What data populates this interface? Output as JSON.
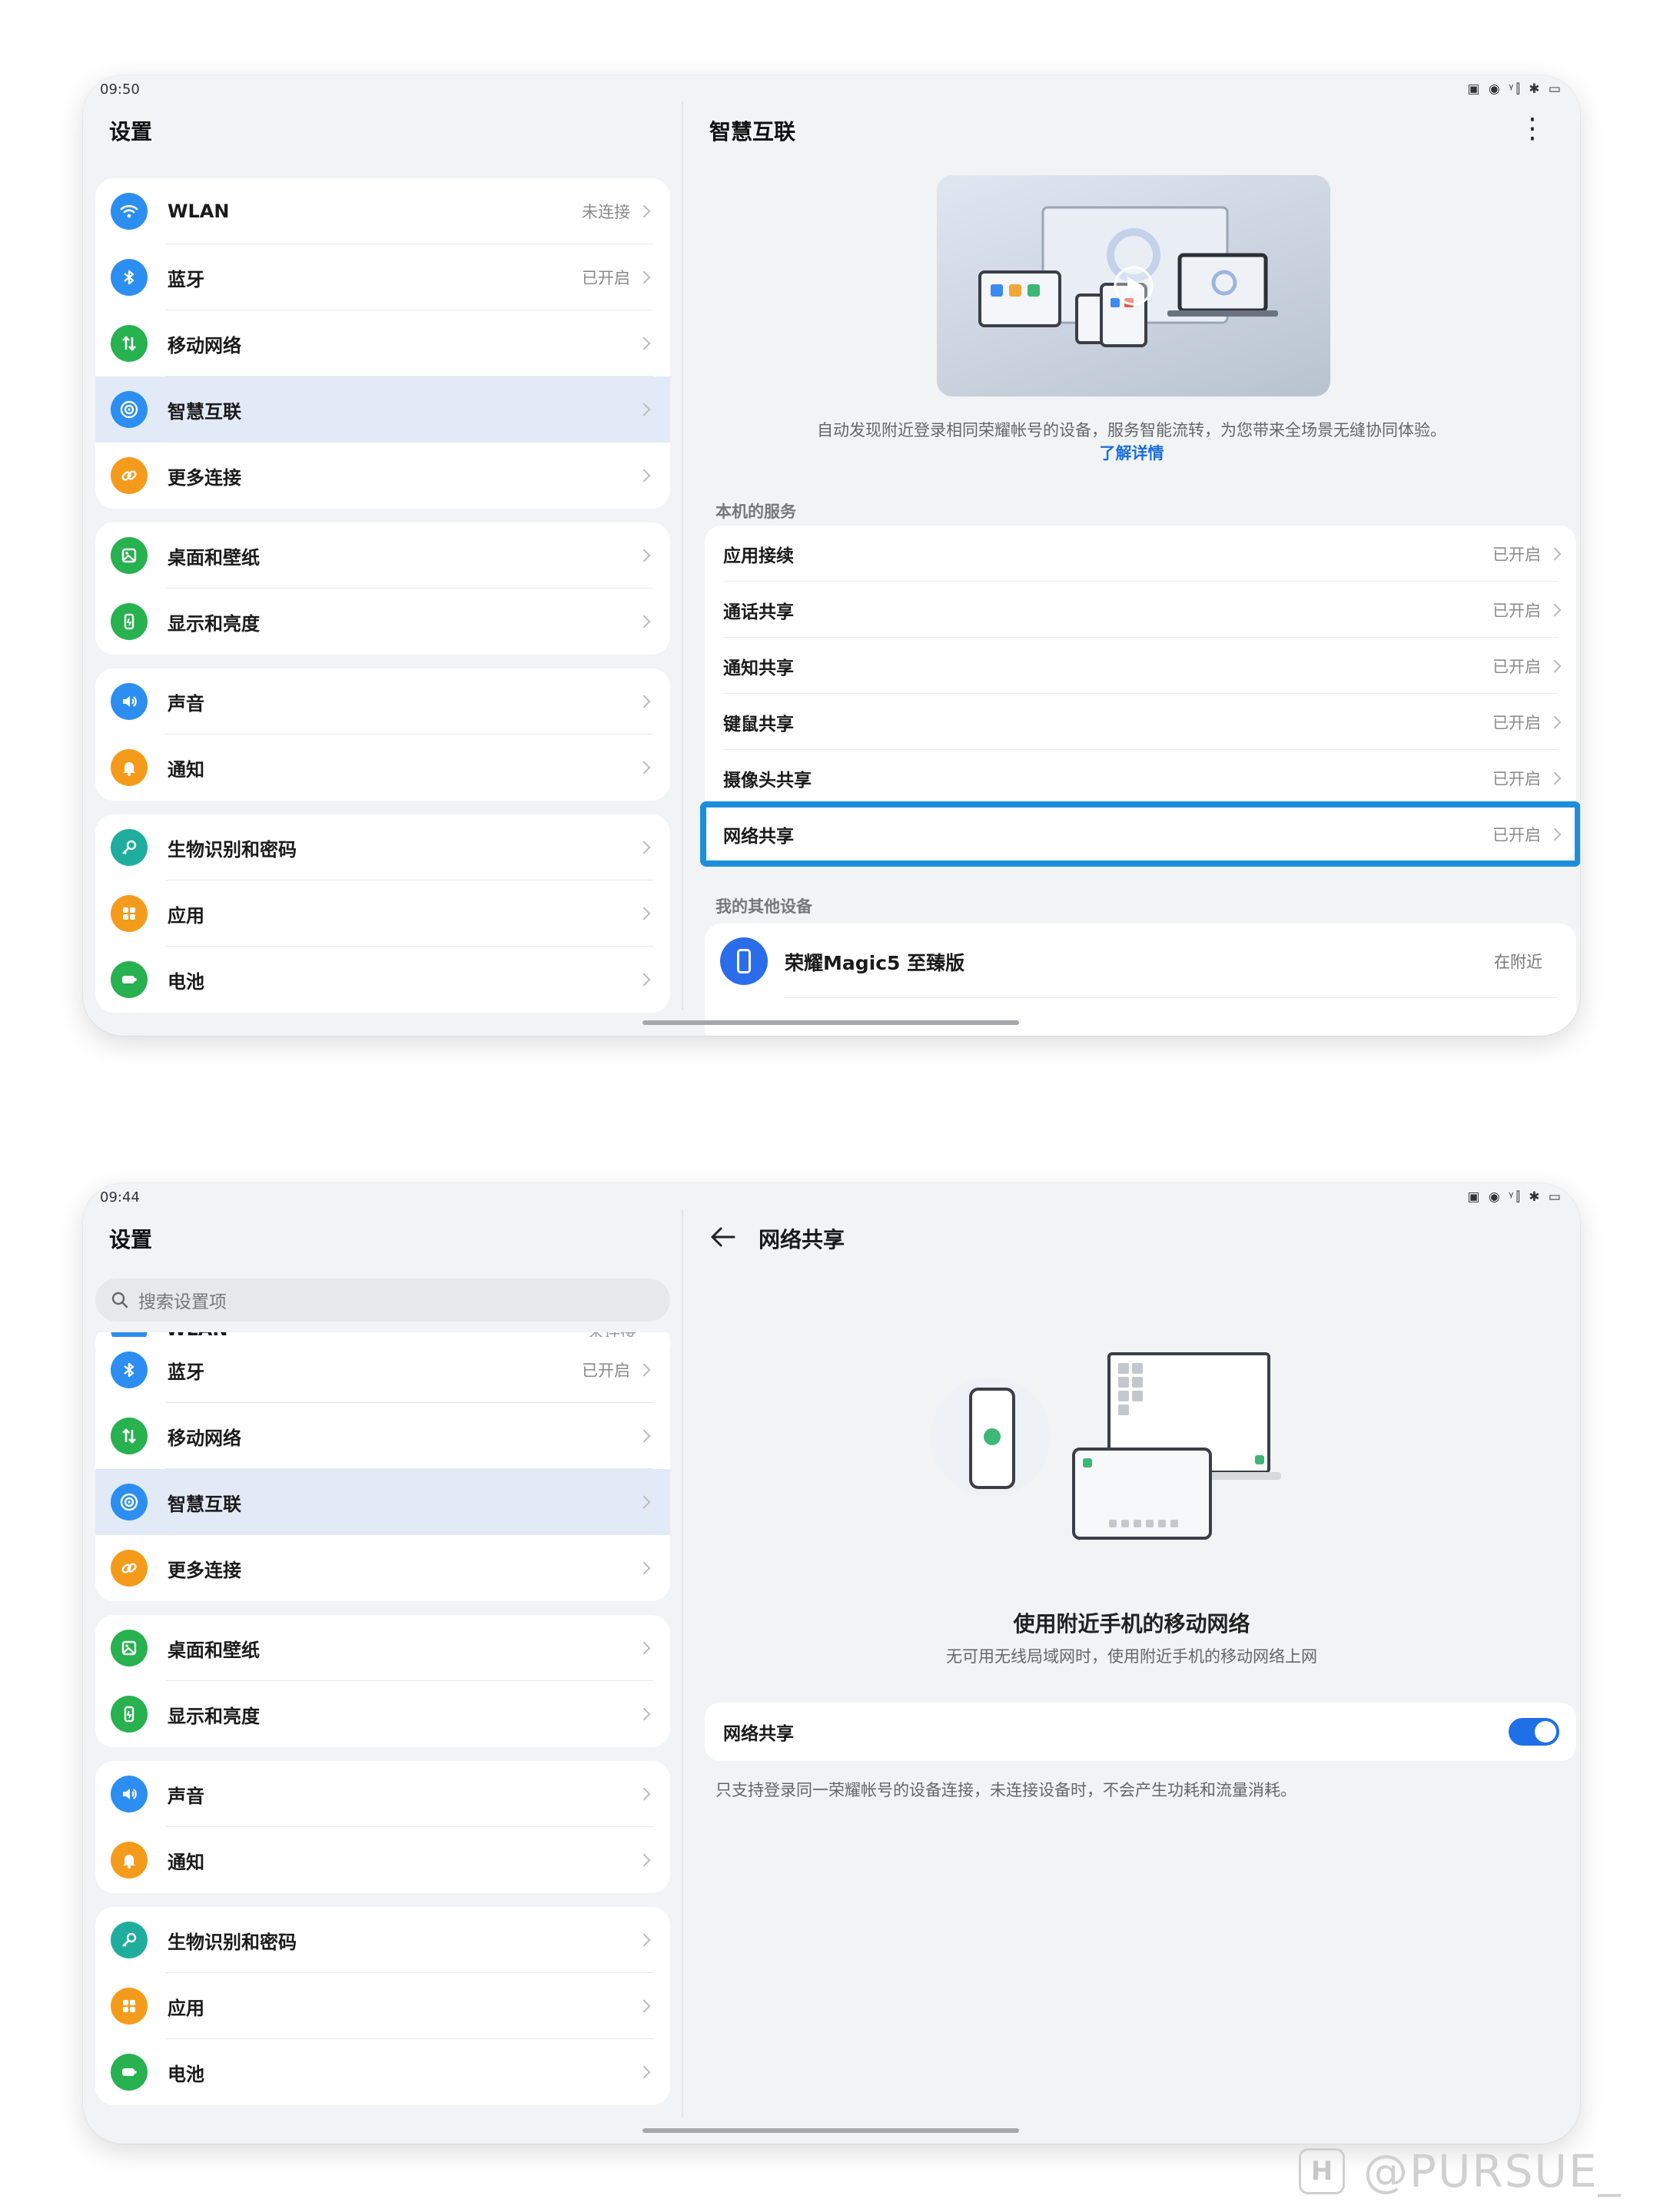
{
  "colors": {
    "accent": "#1a6fdb",
    "highlight_border": "#1b8fdc",
    "selected_row": "#e2eaf8",
    "background": "#f1f3f5"
  },
  "screen_a": {
    "status_time": "09:50",
    "status_icons": "▣ ◉ ᵞ⫿ ✱ ▭",
    "left_title": "设置",
    "groups": [
      {
        "items": [
          {
            "label": "WLAN",
            "value": "未连接",
            "icon": "wifi-icon",
            "color": "#2c8ef0"
          },
          {
            "label": "蓝牙",
            "value": "已开启",
            "icon": "bluetooth-icon",
            "color": "#2c8ef0"
          },
          {
            "label": "移动网络",
            "value": "",
            "icon": "mobile-data-icon",
            "color": "#27b14f"
          },
          {
            "label": "智慧互联",
            "value": "",
            "icon": "smart-connect-icon",
            "color": "#2c8ef0",
            "selected": true
          },
          {
            "label": "更多连接",
            "value": "",
            "icon": "link-icon",
            "color": "#f59b1c"
          }
        ]
      },
      {
        "items": [
          {
            "label": "桌面和壁纸",
            "value": "",
            "icon": "wallpaper-icon",
            "color": "#27b14f"
          },
          {
            "label": "显示和亮度",
            "value": "",
            "icon": "display-icon",
            "color": "#27b14f"
          }
        ]
      },
      {
        "items": [
          {
            "label": "声音",
            "value": "",
            "icon": "sound-icon",
            "color": "#2c8ef0"
          },
          {
            "label": "通知",
            "value": "",
            "icon": "bell-icon",
            "color": "#f59b1c"
          }
        ]
      },
      {
        "items": [
          {
            "label": "生物识别和密码",
            "value": "",
            "icon": "key-icon",
            "color": "#1fae9d"
          },
          {
            "label": "应用",
            "value": "",
            "icon": "apps-icon",
            "color": "#f59b1c"
          },
          {
            "label": "电池",
            "value": "",
            "icon": "battery-icon",
            "color": "#27b14f"
          }
        ]
      }
    ],
    "right_title": "智慧互联",
    "more_glyph": "⋮",
    "description": "自动发现附近登录相同荣耀帐号的设备，服务智能流转，为您带来全场景无缝协同体验。",
    "learn_more": "了解详情",
    "services_label": "本机的服务",
    "services": [
      {
        "label": "应用接续",
        "value": "已开启"
      },
      {
        "label": "通话共享",
        "value": "已开启"
      },
      {
        "label": "通知共享",
        "value": "已开启"
      },
      {
        "label": "键鼠共享",
        "value": "已开启"
      },
      {
        "label": "摄像头共享",
        "value": "已开启"
      },
      {
        "label": "网络共享",
        "value": "已开启",
        "highlighted": true
      }
    ],
    "other_devices_label": "我的其他设备",
    "device": {
      "name": "荣耀Magic5 至臻版",
      "status": "在附近"
    }
  },
  "screen_b": {
    "status_time": "09:44",
    "status_icons": "▣ ◉ ᵞ⫿ ✱ ▭",
    "left_title": "设置",
    "search_placeholder": "搜索设置项",
    "cut_row": {
      "label": "WLAN",
      "value": "未连接"
    },
    "groups": [
      {
        "items": [
          {
            "label": "蓝牙",
            "value": "已开启",
            "icon": "bluetooth-icon",
            "color": "#2c8ef0"
          },
          {
            "label": "移动网络",
            "value": "",
            "icon": "mobile-data-icon",
            "color": "#27b14f"
          },
          {
            "label": "智慧互联",
            "value": "",
            "icon": "smart-connect-icon",
            "color": "#2c8ef0",
            "selected": true
          },
          {
            "label": "更多连接",
            "value": "",
            "icon": "link-icon",
            "color": "#f59b1c"
          }
        ]
      },
      {
        "items": [
          {
            "label": "桌面和壁纸",
            "value": "",
            "icon": "wallpaper-icon",
            "color": "#27b14f"
          },
          {
            "label": "显示和亮度",
            "value": "",
            "icon": "display-icon",
            "color": "#27b14f"
          }
        ]
      },
      {
        "items": [
          {
            "label": "声音",
            "value": "",
            "icon": "sound-icon",
            "color": "#2c8ef0"
          },
          {
            "label": "通知",
            "value": "",
            "icon": "bell-icon",
            "color": "#f59b1c"
          }
        ]
      },
      {
        "items": [
          {
            "label": "生物识别和密码",
            "value": "",
            "icon": "key-icon",
            "color": "#1fae9d"
          },
          {
            "label": "应用",
            "value": "",
            "icon": "apps-icon",
            "color": "#f59b1c"
          },
          {
            "label": "电池",
            "value": "",
            "icon": "battery-icon",
            "color": "#27b14f"
          }
        ]
      }
    ],
    "right_title": "网络共享",
    "hero_title": "使用附近手机的移动网络",
    "hero_subtitle": "无可用无线局域网时，使用附近手机的移动网络上网",
    "toggle_label": "网络共享",
    "toggle_on": true,
    "note": "只支持登录同一荣耀帐号的设备连接，未连接设备时，不会产生功耗和流量消耗。"
  },
  "watermark": {
    "icon_letter": "H",
    "text": "@PURSUE_"
  }
}
